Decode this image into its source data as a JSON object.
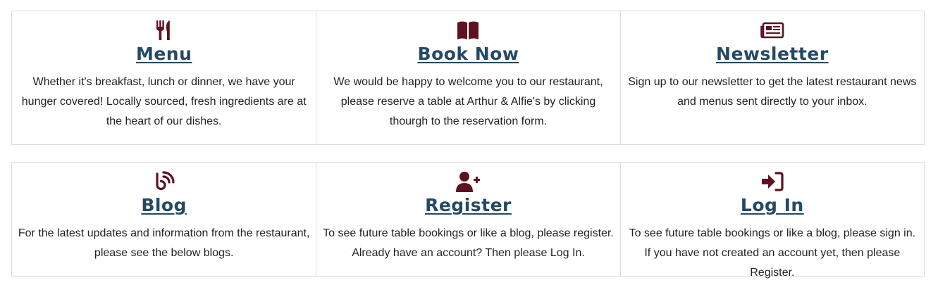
{
  "colors": {
    "icon": "#5e1220",
    "title": "#244a63",
    "text": "#222222",
    "border": "#dcdcdc"
  },
  "cards": [
    {
      "icon": "utensils-icon",
      "title": "Menu",
      "description": "Whether it's breakfast, lunch or dinner, we have your hunger covered! Locally sourced, fresh ingredients are at the heart of our dishes."
    },
    {
      "icon": "book-icon",
      "title": "Book Now",
      "description": "We would be happy to welcome you to our restaurant, please reserve a table at Arthur & Alfie's by clicking thourgh to the reservation form."
    },
    {
      "icon": "newspaper-icon",
      "title": "Newsletter",
      "description": "Sign up to our newsletter to get the latest restaurant news and menus sent directly to your inbox."
    },
    {
      "icon": "blog-icon",
      "title": "Blog",
      "description": "For the latest updates and information from the restaurant, please see the below blogs."
    },
    {
      "icon": "user-plus-icon",
      "title": "Register",
      "description": "To see future table bookings or like a blog, please register. Already have an account? Then please Log In."
    },
    {
      "icon": "sign-in-icon",
      "title": "Log In",
      "description": "To see future table bookings or like a blog, please sign in. If you have not created an account yet, then please Register."
    }
  ]
}
